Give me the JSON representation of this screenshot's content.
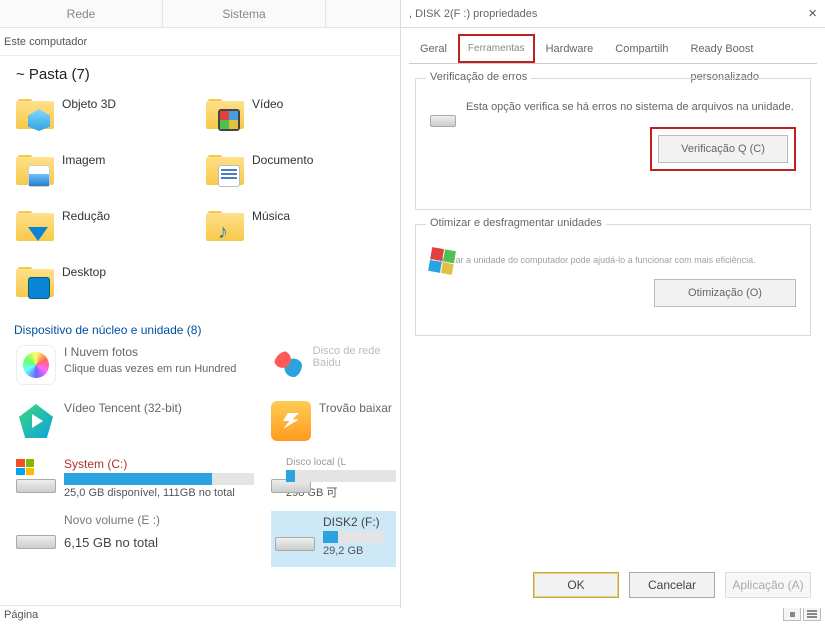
{
  "menubar": {
    "rede": "Rede",
    "sistema": "Sistema"
  },
  "breadcrumb": "Este computador",
  "folders": {
    "title": "~ Pasta (7)",
    "items": [
      {
        "label": "Objeto 3D"
      },
      {
        "label": "Vídeo"
      },
      {
        "label": "Imagem"
      },
      {
        "label": "Documento"
      },
      {
        "label": "Redução"
      },
      {
        "label": "Música"
      },
      {
        "label": "Desktop"
      }
    ]
  },
  "devices": {
    "title": "Dispositivo de núcleo e unidade (8)",
    "cloud_photos": {
      "label": "I Nuvem fotos",
      "sub": "Clique duas vezes em run Hundred"
    },
    "baidu": {
      "label": "Disco de rede Baidu"
    },
    "tencent": {
      "label": "Vídeo Tencent (32-bit)"
    },
    "thunder": {
      "label": "Trovão baixar"
    },
    "system_c": {
      "name": "System (C:)",
      "cap": "25,0 GB disponível, 111GB no total"
    },
    "local_l": {
      "name": "Disco local (L",
      "cap": "298 GB 可"
    },
    "volume_e": {
      "name": "Novo volume (E :)",
      "cap": "6,15 GB no total"
    },
    "disk2_f": {
      "name": "DISK2 (F:)",
      "cap": "29,2 GB"
    }
  },
  "status": {
    "page": "Página"
  },
  "dialog": {
    "title": ", DISK 2(F :) propriedades",
    "tabs": {
      "geral": "Geral",
      "ferramentas": "Ferramentas",
      "hardware": "Hardware",
      "compartilhar": "Compartilh",
      "readyboost": "Ready Boost personalizado"
    },
    "errcheck": {
      "legend": "Verificação de erros",
      "text": "Esta opção verifica se há erros no sistema de arquivos na unidade.",
      "button": "Verificação Q (C)"
    },
    "optimize": {
      "legend": "Otimizar e desfragmentar unidades",
      "text": "Otimizar a unidade do computador pode ajudá-lo a funcionar com mais eficiência.",
      "button": "Otimização (O)"
    },
    "buttons": {
      "ok": "OK",
      "cancel": "Cancelar",
      "apply": "Aplicação (A)"
    }
  }
}
